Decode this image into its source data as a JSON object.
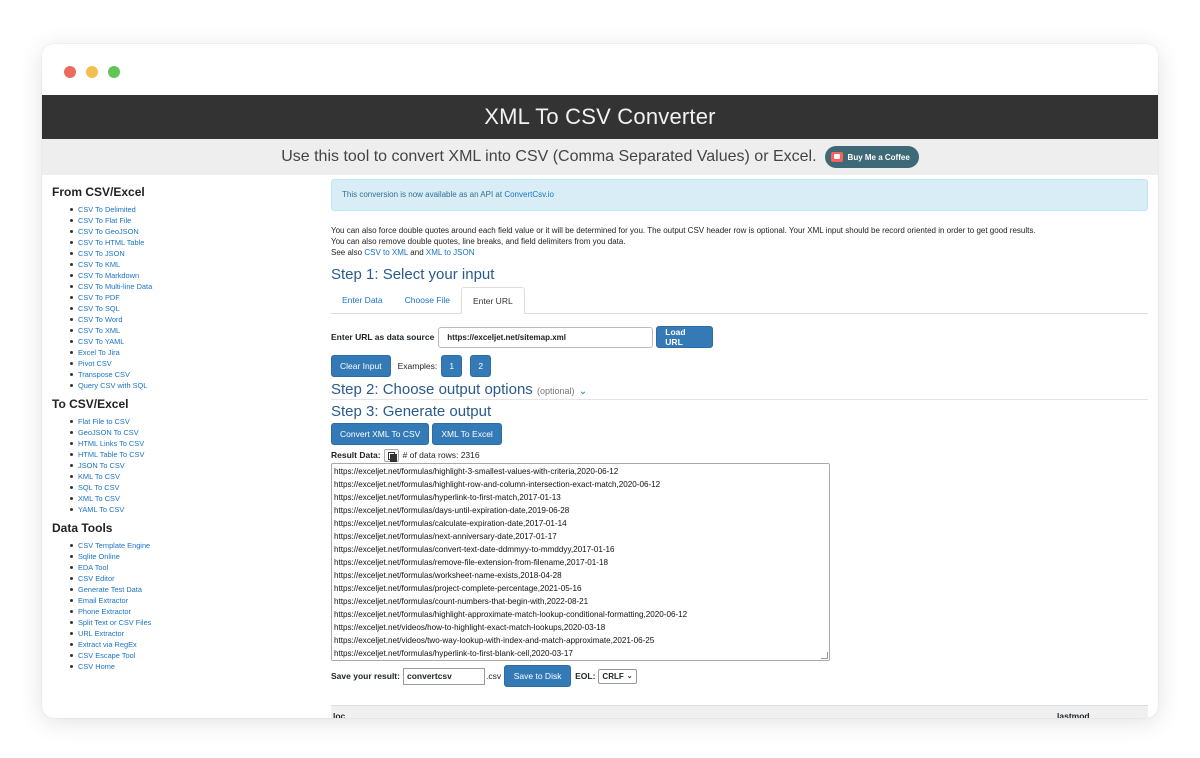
{
  "header": {
    "title": "XML To CSV Converter",
    "subtitle": "Use this tool to convert XML into CSV (Comma Separated Values) or Excel.",
    "coffee_label": "Buy Me a Coffee"
  },
  "sidebar": {
    "sections": [
      {
        "title": "From CSV/Excel",
        "items": [
          "CSV To Delimited",
          "CSV To Flat File",
          "CSV To GeoJSON",
          "CSV To HTML Table",
          "CSV To JSON",
          "CSV To KML",
          "CSV To Markdown",
          "CSV To Multi-line Data",
          "CSV To PDF",
          "CSV To SQL",
          "CSV To Word",
          "CSV To XML",
          "CSV To YAML",
          "Excel To Jira",
          "Pivot CSV",
          "Transpose CSV",
          "Query CSV with SQL"
        ]
      },
      {
        "title": "To CSV/Excel",
        "items": [
          "Flat File to CSV",
          "GeoJSON To CSV",
          "HTML Links To CSV",
          "HTML Table To CSV",
          "JSON To CSV",
          "KML To CSV",
          "SQL To CSV",
          "XML To CSV",
          "YAML To CSV"
        ]
      },
      {
        "title": "Data Tools",
        "items": [
          "CSV Template Engine",
          "Sqlite Online",
          "EDA Tool",
          "CSV Editor",
          "Generate Test Data",
          "Email Extractor",
          "Phone Extractor",
          "Split Text or CSV Files",
          "URL Extractor",
          "Extract via RegEx",
          "CSV Escape Tool",
          "CSV Home"
        ]
      }
    ]
  },
  "alert": {
    "text": "This conversion is now available as an API at ",
    "link": "ConvertCsv.io"
  },
  "intro": {
    "line1": "You can also force double quotes around each field value or it will be determined for you. The output CSV header row is optional. Your XML input should be record oriented in order to get good results.",
    "line2": "You can also remove double quotes, line breaks, and field delimiters from you data.",
    "see_also": "See also ",
    "link1": "CSV to XML",
    "and": " and ",
    "link2": "XML to JSON"
  },
  "step1": {
    "title": "Step 1: Select your input",
    "tabs": [
      "Enter Data",
      "Choose File",
      "Enter URL"
    ],
    "active_tab": "Enter URL",
    "url_label": "Enter URL as data source",
    "url_value": "https://exceljet.net/sitemap.xml",
    "load_button": "Load URL",
    "clear_button": "Clear Input",
    "examples_label": "Examples:",
    "example_1": "1",
    "example_2": "2"
  },
  "step2": {
    "title": "Step 2: Choose output options",
    "optional": "(optional)"
  },
  "step3": {
    "title": "Step 3: Generate output",
    "convert_button": "Convert XML To CSV",
    "excel_button": "XML To Excel",
    "result_label": "Result Data:",
    "rows_text": "# of data rows: 2316",
    "output_lines": [
      "https://exceljet.net/formulas/highlight-3-smallest-values-with-criteria,2020-06-12",
      "https://exceljet.net/formulas/highlight-row-and-column-intersection-exact-match,2020-06-12",
      "https://exceljet.net/formulas/hyperlink-to-first-match,2017-01-13",
      "https://exceljet.net/formulas/days-until-expiration-date,2019-06-28",
      "https://exceljet.net/formulas/calculate-expiration-date,2017-01-14",
      "https://exceljet.net/formulas/next-anniversary-date,2017-01-17",
      "https://exceljet.net/formulas/convert-text-date-ddmmyy-to-mmddyy,2017-01-16",
      "https://exceljet.net/formulas/remove-file-extension-from-filename,2017-01-18",
      "https://exceljet.net/formulas/worksheet-name-exists,2018-04-28",
      "https://exceljet.net/formulas/project-complete-percentage,2021-05-16",
      "https://exceljet.net/formulas/count-numbers-that-begin-with,2022-08-21",
      "https://exceljet.net/formulas/highlight-approximate-match-lookup-conditional-formatting,2020-06-12",
      "https://exceljet.net/videos/how-to-highlight-exact-match-lookups,2020-03-18",
      "https://exceljet.net/videos/two-way-lookup-with-index-and-match-approximate,2021-06-25",
      "https://exceljet.net/formulas/hyperlink-to-first-blank-cell,2020-03-17"
    ],
    "save_label": "Save your result:",
    "filename": "convertcsv",
    "extension": ".csv",
    "save_button": "Save to Disk",
    "eol_label": "EOL:",
    "eol_value": "CRLF"
  },
  "table": {
    "headers": [
      "loc",
      "lastmod"
    ]
  }
}
